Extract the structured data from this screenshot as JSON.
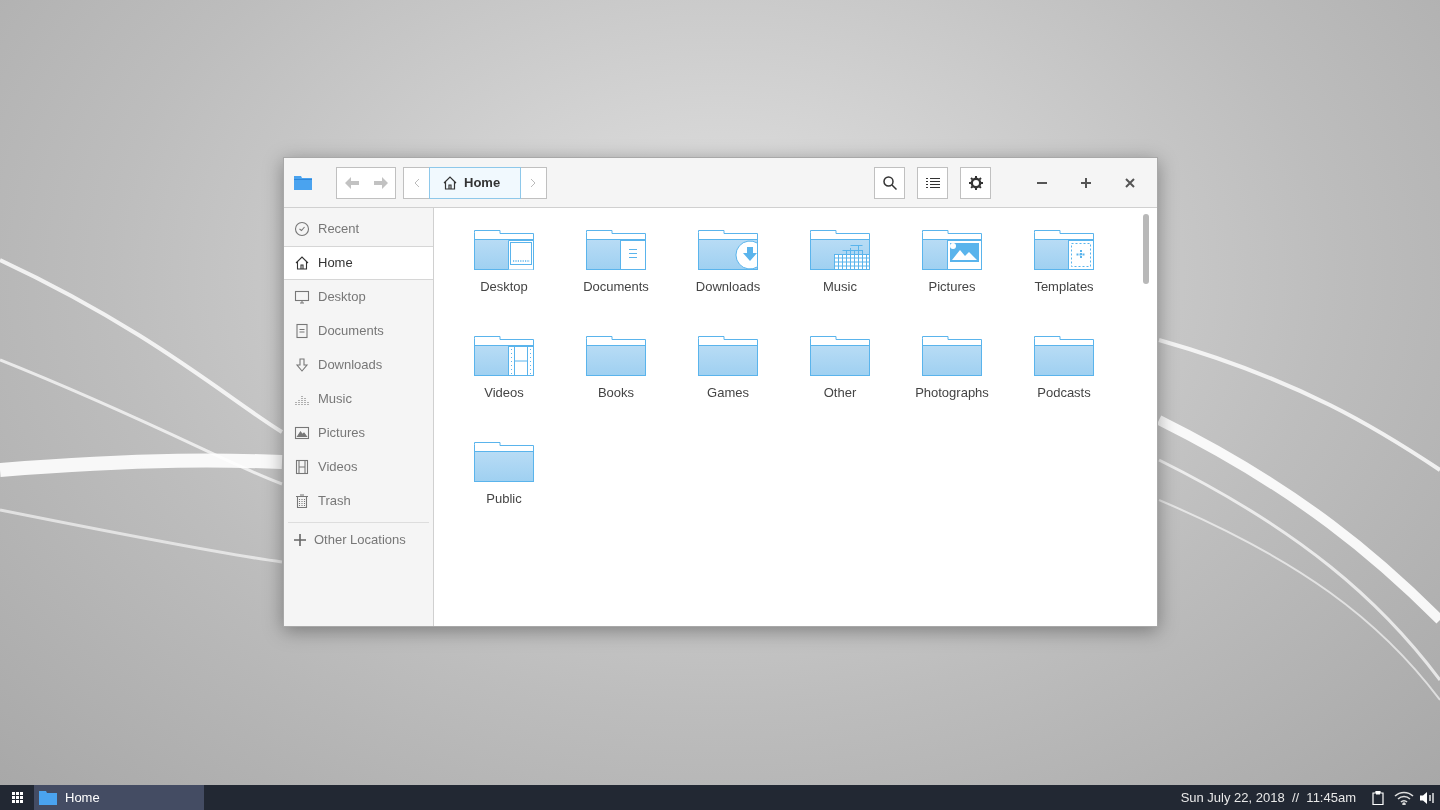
{
  "toolbar": {
    "back_enabled": false,
    "forward_enabled": false,
    "path": [
      {
        "label": "Home",
        "selected": true
      }
    ]
  },
  "sidebar": {
    "items": [
      {
        "label": "Recent",
        "kind": "recent",
        "selected": false
      },
      {
        "label": "Home",
        "kind": "home",
        "selected": true
      },
      {
        "label": "Desktop",
        "kind": "desktop",
        "selected": false
      },
      {
        "label": "Documents",
        "kind": "documents",
        "selected": false
      },
      {
        "label": "Downloads",
        "kind": "downloads",
        "selected": false
      },
      {
        "label": "Music",
        "kind": "music",
        "selected": false
      },
      {
        "label": "Pictures",
        "kind": "pictures",
        "selected": false
      },
      {
        "label": "Videos",
        "kind": "videos",
        "selected": false
      },
      {
        "label": "Trash",
        "kind": "trash",
        "selected": false
      }
    ],
    "other_locations": "Other Locations"
  },
  "folders": [
    {
      "label": "Desktop",
      "kind": "desktop"
    },
    {
      "label": "Documents",
      "kind": "documents"
    },
    {
      "label": "Downloads",
      "kind": "downloads"
    },
    {
      "label": "Music",
      "kind": "music"
    },
    {
      "label": "Pictures",
      "kind": "pictures"
    },
    {
      "label": "Templates",
      "kind": "templates"
    },
    {
      "label": "Videos",
      "kind": "videos"
    },
    {
      "label": "Books",
      "kind": "plain"
    },
    {
      "label": "Games",
      "kind": "plain"
    },
    {
      "label": "Other",
      "kind": "plain"
    },
    {
      "label": "Photographs",
      "kind": "plain"
    },
    {
      "label": "Podcasts",
      "kind": "plain"
    },
    {
      "label": "Public",
      "kind": "plain"
    }
  ],
  "taskbar": {
    "tasks": [
      {
        "label": "Home",
        "selected": true
      }
    ],
    "clock": "Sun July 22, 2018  //  11:45am"
  }
}
